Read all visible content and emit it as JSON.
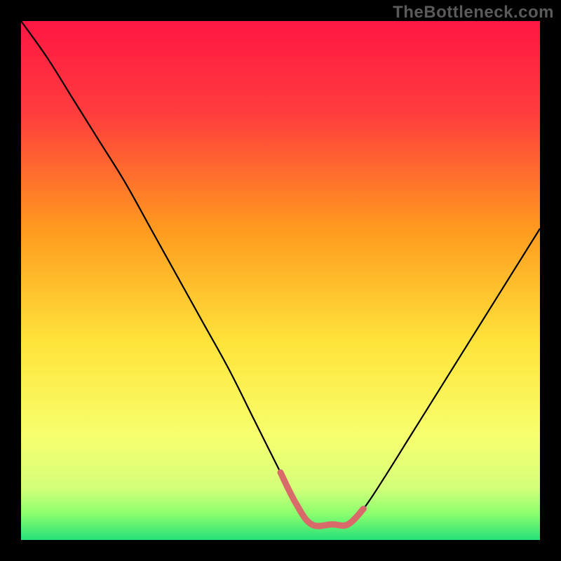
{
  "watermark": "TheBottleneck.com",
  "chart_data": {
    "type": "line",
    "title": "",
    "xlabel": "",
    "ylabel": "",
    "xlim": [
      0,
      100
    ],
    "ylim": [
      0,
      100
    ],
    "gradient_stops": [
      {
        "offset": 0,
        "color": "#ff1744"
      },
      {
        "offset": 18,
        "color": "#ff3d3d"
      },
      {
        "offset": 40,
        "color": "#ff9a1f"
      },
      {
        "offset": 62,
        "color": "#ffe43a"
      },
      {
        "offset": 80,
        "color": "#f7ff6e"
      },
      {
        "offset": 90,
        "color": "#d4ff7a"
      },
      {
        "offset": 95,
        "color": "#8aff6e"
      },
      {
        "offset": 100,
        "color": "#27e07a"
      }
    ],
    "series": [
      {
        "name": "bottleneck-curve",
        "stroke": "#000000",
        "stroke_width": 2.2,
        "x": [
          0,
          5,
          10,
          15,
          20,
          25,
          30,
          35,
          40,
          45,
          50,
          53,
          56,
          60,
          63,
          66,
          70,
          75,
          80,
          85,
          90,
          95,
          100
        ],
        "values": [
          100,
          93,
          85,
          77,
          69,
          60,
          51,
          42,
          33,
          23,
          13,
          7,
          3,
          3,
          3,
          6,
          12,
          20,
          28,
          36,
          44,
          52,
          60
        ]
      },
      {
        "name": "optimal-range-marker",
        "stroke": "#d86a6a",
        "stroke_width": 9,
        "linecap": "round",
        "x": [
          50,
          53,
          56,
          60,
          63,
          66
        ],
        "values": [
          13,
          7,
          3,
          3,
          3,
          6
        ]
      }
    ]
  }
}
